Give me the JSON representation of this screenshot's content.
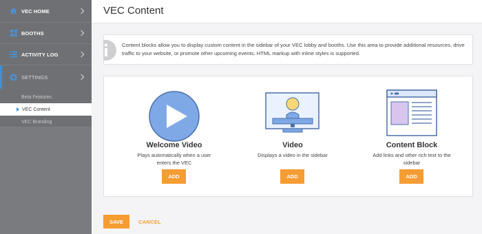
{
  "sidebar": {
    "items": [
      {
        "label": "VEC HOME",
        "icon": "home-icon"
      },
      {
        "label": "BOOTHS",
        "icon": "grid-icon"
      },
      {
        "label": "ACTIVITY LOG",
        "icon": "list-icon"
      },
      {
        "label": "SETTINGS",
        "icon": "gear-icon"
      }
    ],
    "subitems": [
      {
        "label": "Beta Features"
      },
      {
        "label": "VEC Content",
        "active": true
      },
      {
        "label": "VEC Branding"
      }
    ]
  },
  "page": {
    "title": "VEC Content",
    "info": "Content blocks allow you to display custom content in the sidebar of your VEC lobby and booths. Use this area to provide additional resources, drive traffic to your website, or promote other upcoming events. HTML markup with inline styles is supported."
  },
  "blocks": [
    {
      "title": "Welcome Video",
      "description": "Plays automatically when a user enters the VEC",
      "button": "ADD",
      "icon": "play-icon"
    },
    {
      "title": "Video",
      "description": "Displays a video in the sidebar",
      "button": "ADD",
      "icon": "video-monitor-icon"
    },
    {
      "title": "Content Block",
      "description": "Add links and other rich text to the sidebar",
      "button": "ADD",
      "icon": "content-block-icon"
    }
  ],
  "footer": {
    "save": "SAVE",
    "cancel": "CANCEL"
  },
  "colors": {
    "accent": "#f59c32",
    "sidebar": "#6f7073",
    "highlight": "#3d8fd6",
    "illustration_blue": "#7fa9e6"
  }
}
